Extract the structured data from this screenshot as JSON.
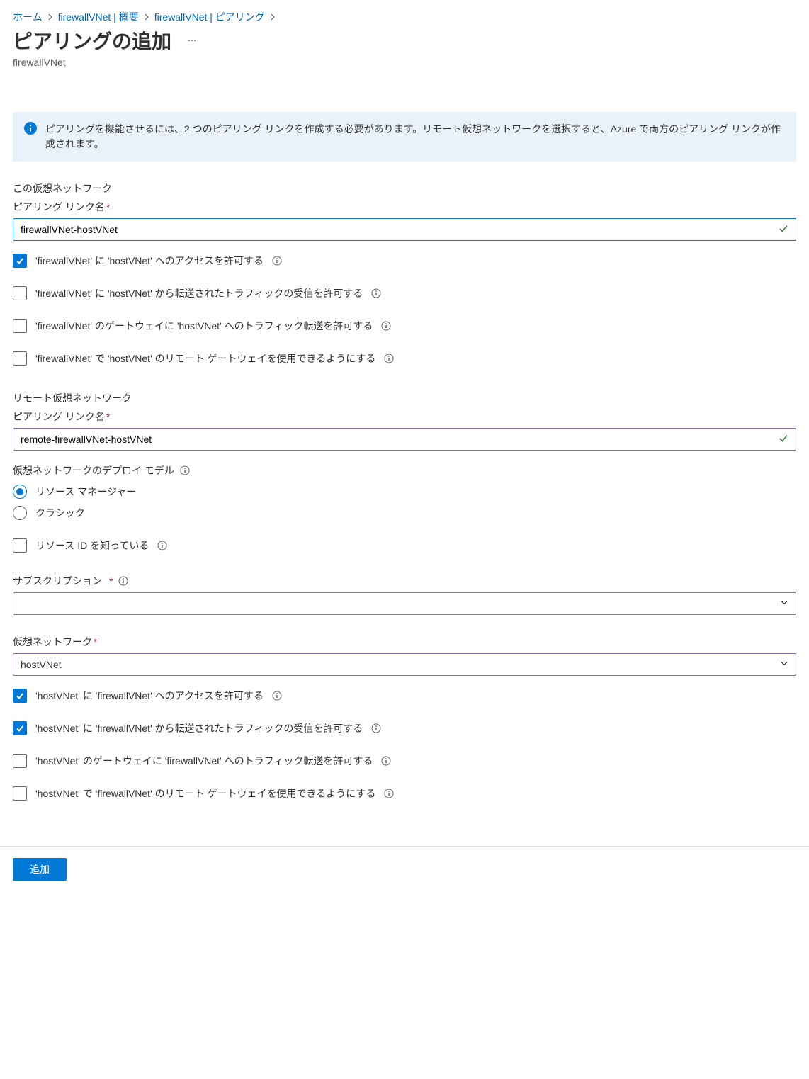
{
  "breadcrumb": {
    "home": "ホーム",
    "overview": "firewallVNet | 概要",
    "peering": "firewallVNet | ピアリング"
  },
  "header": {
    "title": "ピアリングの追加",
    "subtitle": "firewallVNet"
  },
  "banner": {
    "text": "ピアリングを機能させるには、2 つのピアリング リンクを作成する必要があります。リモート仮想ネットワークを選択すると、Azure で両方のピアリング リンクが作成されます。"
  },
  "local": {
    "title": "この仮想ネットワーク",
    "link_name_label": "ピアリング リンク名",
    "link_name_value": "firewallVNet-hostVNet",
    "chk_access": "'firewallVNet' に 'hostVNet' へのアクセスを許可する",
    "chk_forwarded": "'firewallVNet' に 'hostVNet' から転送されたトラフィックの受信を許可する",
    "chk_gw_transit": "'firewallVNet' のゲートウェイに 'hostVNet' へのトラフィック転送を許可する",
    "chk_remote_gw": "'firewallVNet' で 'hostVNet' のリモート ゲートウェイを使用できるようにする"
  },
  "remote": {
    "title": "リモート仮想ネットワーク",
    "link_name_label": "ピアリング リンク名",
    "link_name_value": "remote-firewallVNet-hostVNet",
    "deploy_model_label": "仮想ネットワークのデプロイ モデル",
    "deploy_model_rm": "リソース マネージャー",
    "deploy_model_classic": "クラシック",
    "know_resid": "リソース ID を知っている",
    "subscription_label": "サブスクリプション",
    "subscription_value": "",
    "vnet_label": "仮想ネットワーク",
    "vnet_value": "hostVNet",
    "chk_access": "'hostVNet' に 'firewallVNet' へのアクセスを許可する",
    "chk_forwarded": "'hostVNet' に 'firewallVNet' から転送されたトラフィックの受信を許可する",
    "chk_gw_transit": "'hostVNet' のゲートウェイに 'firewallVNet' へのトラフィック転送を許可する",
    "chk_remote_gw": "'hostVNet' で 'firewallVNet' のリモート ゲートウェイを使用できるようにする"
  },
  "footer": {
    "add": "追加"
  }
}
